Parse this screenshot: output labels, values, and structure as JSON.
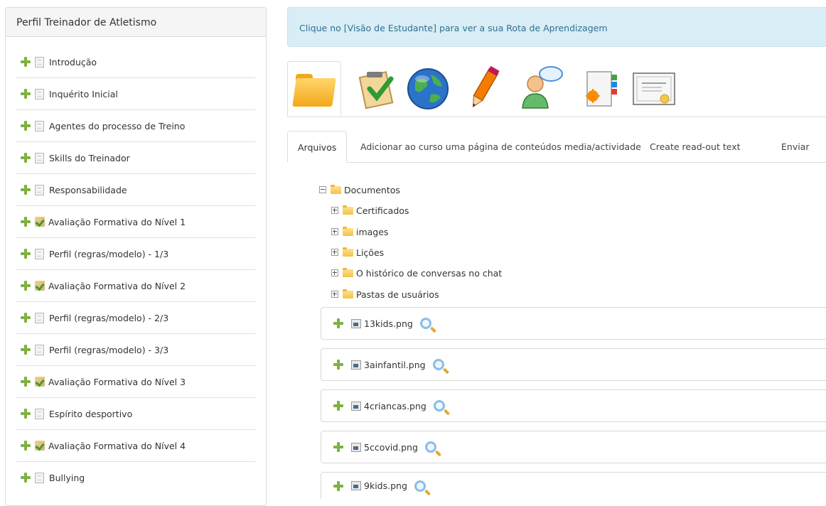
{
  "sidebar": {
    "title": "Perfil Treinador de Atletismo",
    "items": [
      {
        "label": "Introdução",
        "icon": "document-icon"
      },
      {
        "label": "Inquérito Inicial",
        "icon": "document-icon"
      },
      {
        "label": "Agentes do processo de Treino",
        "icon": "document-icon"
      },
      {
        "label": "Skills do Treinador",
        "icon": "document-icon"
      },
      {
        "label": "Responsabilidade",
        "icon": "document-icon"
      },
      {
        "label": "Avaliação Formativa do Nível 1",
        "icon": "quiz-icon"
      },
      {
        "label": "Perfil (regras/modelo) - 1/3",
        "icon": "document-icon"
      },
      {
        "label": "Avaliação Formativa do Nível 2",
        "icon": "quiz-icon"
      },
      {
        "label": "Perfil (regras/modelo) - 2/3",
        "icon": "document-icon"
      },
      {
        "label": "Perfil (regras/modelo) - 3/3",
        "icon": "document-icon"
      },
      {
        "label": "Avaliação Formativa do Nível 3",
        "icon": "quiz-icon"
      },
      {
        "label": "Espírito desportivo",
        "icon": "document-icon"
      },
      {
        "label": "Avaliação Formativa do Nível 4",
        "icon": "quiz-icon"
      },
      {
        "label": "Bullying",
        "icon": "document-icon"
      }
    ]
  },
  "info_banner": "Clique no [Visão de Estudante] para ver a sua Rota de Aprendizagem",
  "icon_tabs": [
    "folder-icon",
    "checklist-icon",
    "globe-icon",
    "pencil-icon",
    "user-chat-icon",
    "notebook-icon",
    "certificate-icon"
  ],
  "tabs": [
    {
      "label": "Arquivos"
    },
    {
      "label": "Adicionar ao curso uma página de conteúdos media/actividade"
    },
    {
      "label": "Create read-out text"
    },
    {
      "label": "Enviar"
    }
  ],
  "tree": {
    "root": "Documentos",
    "children": [
      "Certificados",
      "images",
      "Lições",
      "O histórico de conversas no chat",
      "Pastas de usuários"
    ]
  },
  "files": [
    "13kids.png",
    "3ainfantil.png",
    "4criancas.png",
    "5ccovid.png",
    "9kids.png"
  ],
  "colors": {
    "info_bg": "#d9edf7",
    "info_text": "#31708f",
    "plus_green": "#7cb342"
  }
}
